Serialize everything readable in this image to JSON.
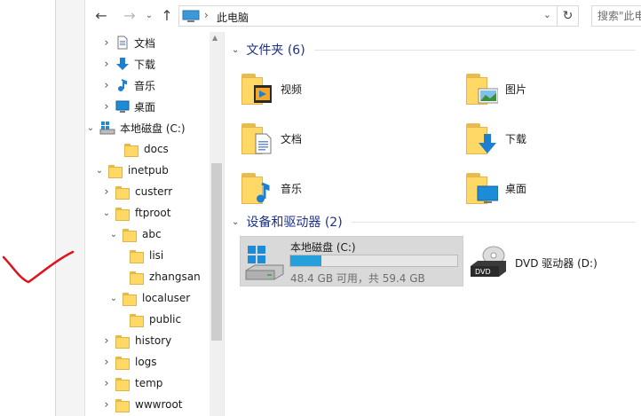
{
  "navigation": {
    "address": "此电脑",
    "search_placeholder": "搜索\"此电",
    "back_glyph": "←",
    "forward_glyph": "→",
    "recent_glyph": "⌄",
    "up_glyph": "↑",
    "refresh_glyph": "↻"
  },
  "tree": {
    "items": [
      {
        "label": "文档",
        "icon": "document-icon",
        "expanded": false
      },
      {
        "label": "下载",
        "icon": "download-icon",
        "expanded": false
      },
      {
        "label": "音乐",
        "icon": "music-icon",
        "expanded": false
      },
      {
        "label": "桌面",
        "icon": "desktop-icon",
        "expanded": false
      },
      {
        "label": "本地磁盘 (C:)",
        "icon": "drive-icon",
        "expanded": true
      },
      {
        "label": "docs",
        "icon": "folder-icon",
        "expanded": null
      },
      {
        "label": "inetpub",
        "icon": "folder-icon",
        "expanded": true
      },
      {
        "label": "custerr",
        "icon": "folder-icon",
        "expanded": false
      },
      {
        "label": "ftproot",
        "icon": "folder-icon",
        "expanded": true
      },
      {
        "label": "abc",
        "icon": "folder-icon",
        "expanded": true
      },
      {
        "label": "lisi",
        "icon": "folder-icon",
        "expanded": null
      },
      {
        "label": "zhangsan",
        "icon": "folder-icon",
        "expanded": null
      },
      {
        "label": "localuser",
        "icon": "folder-icon",
        "expanded": true
      },
      {
        "label": "public",
        "icon": "folder-icon",
        "expanded": null
      },
      {
        "label": "history",
        "icon": "folder-icon",
        "expanded": false
      },
      {
        "label": "logs",
        "icon": "folder-icon",
        "expanded": false
      },
      {
        "label": "temp",
        "icon": "folder-icon",
        "expanded": false
      },
      {
        "label": "wwwroot",
        "icon": "folder-icon",
        "expanded": false
      }
    ]
  },
  "content": {
    "folders_header": "文件夹 (6)",
    "folders": [
      {
        "label": "视频",
        "icon": "video-folder-icon"
      },
      {
        "label": "图片",
        "icon": "pictures-folder-icon"
      },
      {
        "label": "文档",
        "icon": "documents-folder-icon"
      },
      {
        "label": "下载",
        "icon": "downloads-folder-icon"
      },
      {
        "label": "音乐",
        "icon": "music-folder-icon"
      },
      {
        "label": "桌面",
        "icon": "desktop-folder-icon"
      }
    ],
    "devices_header": "设备和驱动器 (2)",
    "drive_c": {
      "name": "本地磁盘 (C:)",
      "free_text": "48.4 GB 可用，共 59.4 GB",
      "used_fraction": 0.185,
      "bar_color": "#26a0da"
    },
    "dvd": {
      "name": "DVD 驱动器 (D:)",
      "badge": "DVD"
    }
  },
  "colors": {
    "header": "#1e3287",
    "selected_tile": "#d9d9d9",
    "annotation": "#e0121c"
  }
}
